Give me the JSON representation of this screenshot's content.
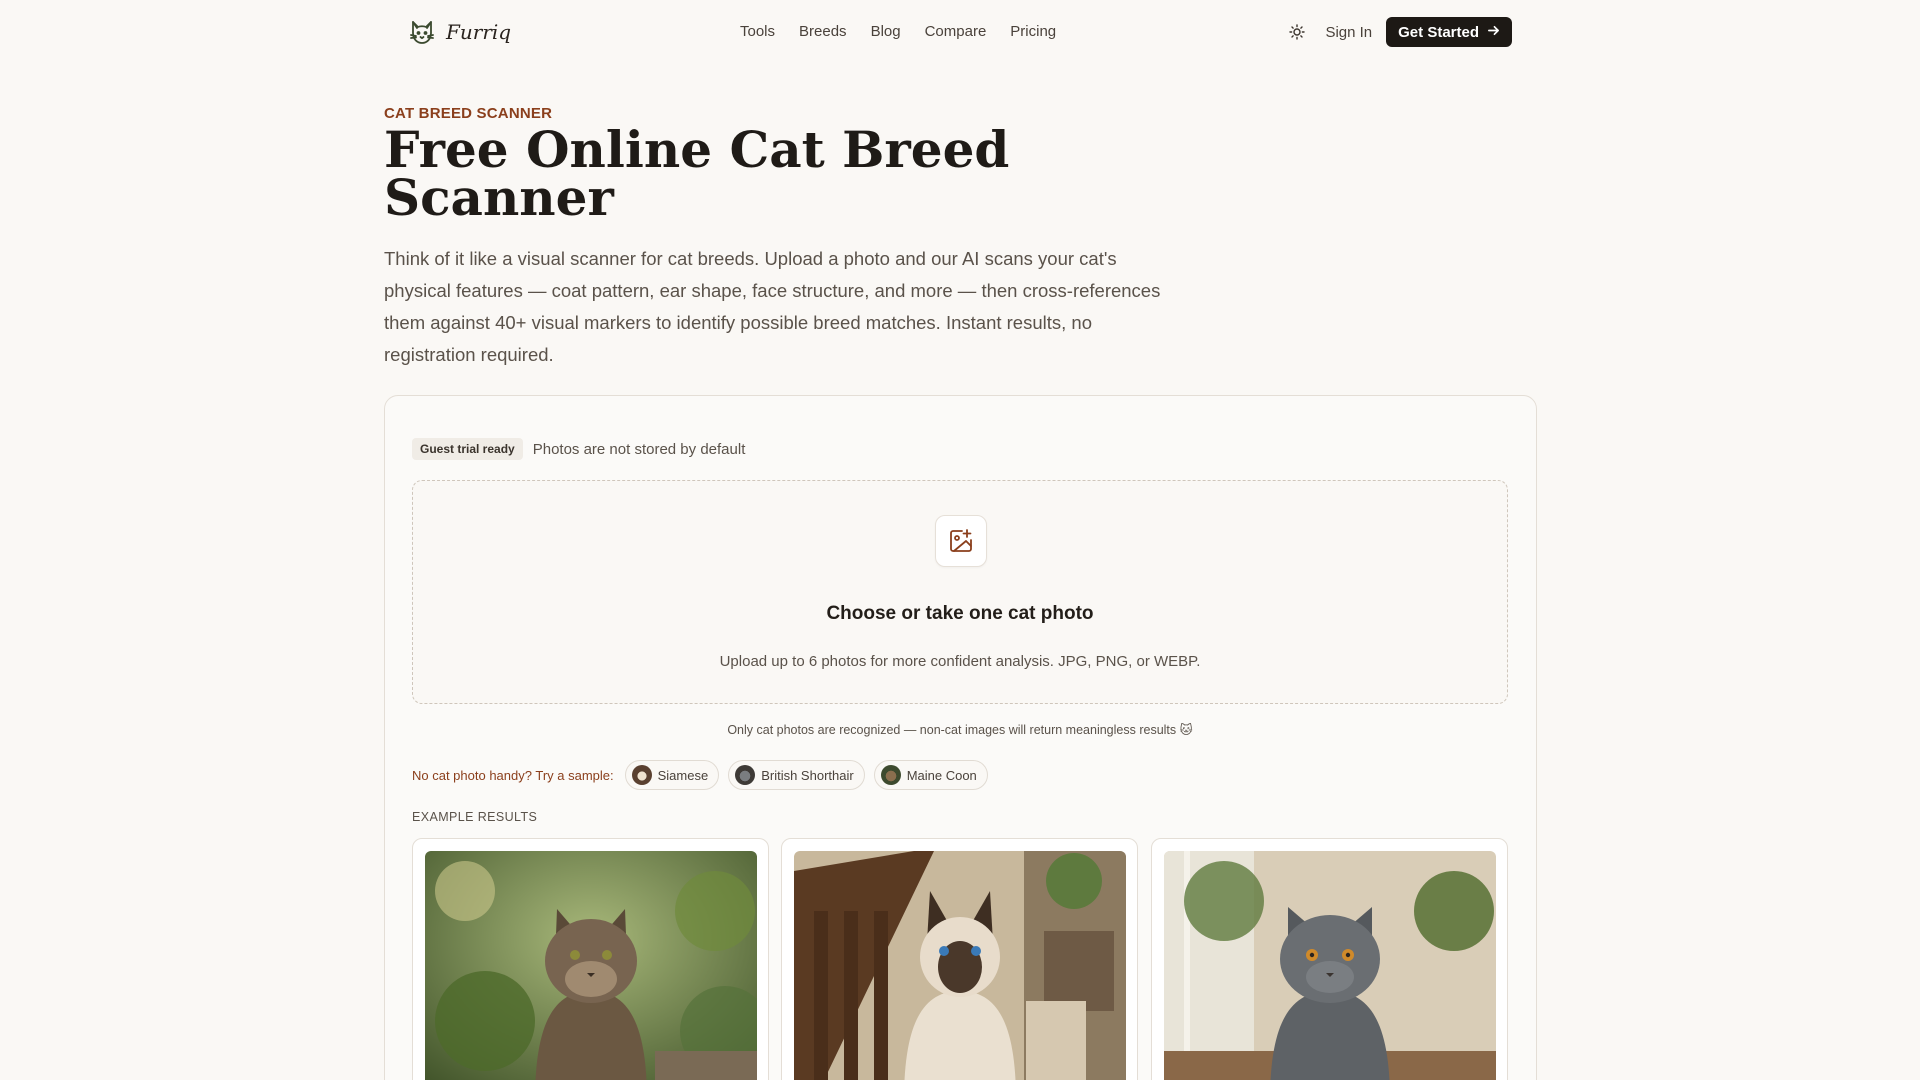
{
  "header": {
    "brand": "Furriq",
    "nav": [
      "Tools",
      "Breeds",
      "Blog",
      "Compare",
      "Pricing"
    ],
    "sign_in": "Sign In",
    "cta": "Get Started"
  },
  "hero": {
    "eyebrow": "CAT BREED SCANNER",
    "title": "Free Online Cat Breed Scanner",
    "description": "Think of it like a visual scanner for cat breeds. Upload a photo and our AI scans your cat's physical features — coat pattern, ear shape, face structure, and more — then cross-references them against 40+ visual markers to identify possible breed matches. Instant results, no registration required."
  },
  "scanner": {
    "badge": "Guest trial ready",
    "privacy": "Photos are not stored by default",
    "upload_title": "Choose or take one cat photo",
    "upload_sub": "Upload up to 6 photos for more confident analysis. JPG, PNG, or WEBP.",
    "notice": "Only cat photos are recognized — non-cat images will return meaningless results 🐱",
    "samples_label": "No cat photo handy? Try a sample:",
    "samples": [
      "Siamese",
      "British Shorthair",
      "Maine Coon"
    ],
    "examples_label": "EXAMPLE RESULTS"
  },
  "icons": {
    "logo": "cat-logo-icon",
    "theme": "sun-icon",
    "cta_arrow": "arrow-right-icon",
    "upload": "image-plus-icon"
  },
  "colors": {
    "accent": "#8b3f1c",
    "background": "#faf8f5",
    "cta": "#1d1915"
  }
}
